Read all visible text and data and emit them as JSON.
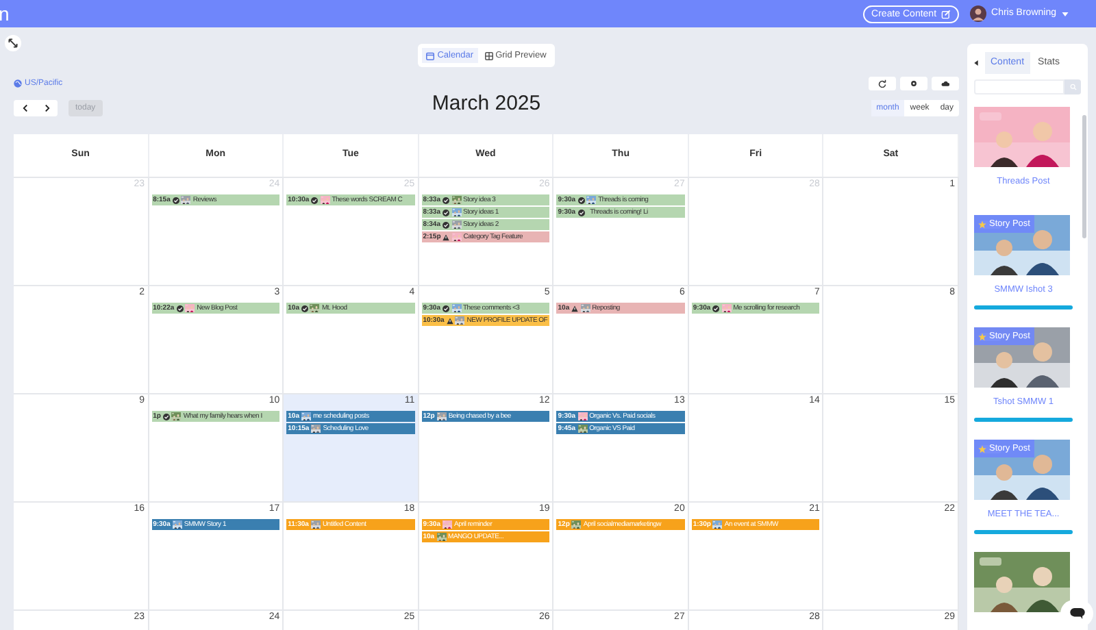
{
  "top_bar": {
    "brand_fragment": "n",
    "create_button": "Create Content",
    "user_name": "Chris Browning"
  },
  "view_toggle": [
    {
      "label": "Calendar",
      "selected": true
    },
    {
      "label": "Grid Preview",
      "selected": false
    }
  ],
  "timezone": "US/Pacific",
  "today_button": {
    "label": "today",
    "disabled": true
  },
  "title": "March 2025",
  "view_buttons": [
    {
      "label": "month",
      "selected": true
    },
    {
      "label": "week",
      "selected": false
    },
    {
      "label": "day",
      "selected": false
    }
  ],
  "weekdays": [
    "Sun",
    "Mon",
    "Tue",
    "Wed",
    "Thu",
    "Fri",
    "Sat"
  ],
  "weeks": [
    {
      "days": [
        {
          "number": "23",
          "other_month": true,
          "today": false
        },
        {
          "number": "24",
          "other_month": true,
          "today": false,
          "events": [
            {
              "time": "8:15a",
              "kind": "published",
              "thumbnail": true,
              "title": "Reviews",
              "color": "#b5d6b0"
            }
          ]
        },
        {
          "number": "25",
          "other_month": true,
          "today": false,
          "events": [
            {
              "time": "10:30a",
              "kind": "published",
              "thumbnail": true,
              "title": "These words SCREAM C",
              "color": "#b5d6b0"
            }
          ]
        },
        {
          "number": "26",
          "other_month": true,
          "today": false,
          "events": [
            {
              "time": "8:33a",
              "kind": "published",
              "thumbnail": true,
              "title": "Story idea 3",
              "color": "#b5d6b0"
            },
            {
              "time": "8:33a",
              "kind": "published",
              "thumbnail": true,
              "title": "Story ideas 1",
              "color": "#b5d6b0"
            },
            {
              "time": "8:34a",
              "kind": "published",
              "thumbnail": true,
              "title": "Story ideas 2",
              "color": "#b5d6b0"
            },
            {
              "time": "2:15p",
              "kind": "warning",
              "thumbnail": true,
              "title": "Category Tag Feature",
              "color": "#e8b4b4"
            }
          ]
        },
        {
          "number": "27",
          "other_month": true,
          "today": false,
          "events": [
            {
              "time": "9:30a",
              "kind": "published",
              "thumbnail": true,
              "title": "Threads is coming",
              "color": "#b5d6b0"
            },
            {
              "time": "9:30a",
              "kind": "published",
              "thumbnail": false,
              "title": "Threads is coming! Li",
              "color": "#b5d6b0"
            }
          ]
        },
        {
          "number": "28",
          "other_month": true,
          "today": false
        },
        {
          "number": "1",
          "other_month": false,
          "today": false
        }
      ]
    },
    {
      "days": [
        {
          "number": "2",
          "other_month": false,
          "today": false
        },
        {
          "number": "3",
          "other_month": false,
          "today": false,
          "events": [
            {
              "time": "10:22a",
              "kind": "published",
              "thumbnail": true,
              "title": "New Blog Post",
              "color": "#b5d6b0"
            }
          ]
        },
        {
          "number": "4",
          "other_month": false,
          "today": false,
          "events": [
            {
              "time": "10a",
              "kind": "published",
              "thumbnail": true,
              "title": "Mt. Hood",
              "color": "#b5d6b0"
            }
          ]
        },
        {
          "number": "5",
          "other_month": false,
          "today": false,
          "events": [
            {
              "time": "9:30a",
              "kind": "published",
              "thumbnail": true,
              "title": "These comments <3",
              "color": "#b5d6b0"
            },
            {
              "time": "10:30a",
              "kind": "warning",
              "thumbnail": true,
              "title": "NEW PROFILE UPDATE OF",
              "color": "#fbbf47"
            }
          ]
        },
        {
          "number": "6",
          "other_month": false,
          "today": false,
          "events": [
            {
              "time": "10a",
              "kind": "warning",
              "thumbnail": true,
              "title": "Reposting",
              "color": "#e8b4b4"
            }
          ]
        },
        {
          "number": "7",
          "other_month": false,
          "today": false,
          "events": [
            {
              "time": "9:30a",
              "kind": "published",
              "thumbnail": true,
              "title": "Me scrolling for research",
              "color": "#b5d6b0"
            }
          ]
        },
        {
          "number": "8",
          "other_month": false,
          "today": false
        }
      ]
    },
    {
      "days": [
        {
          "number": "9",
          "other_month": false,
          "today": false
        },
        {
          "number": "10",
          "other_month": false,
          "today": false,
          "events": [
            {
              "time": "1p",
              "kind": "published",
              "thumbnail": true,
              "title": "What my family hears when I",
              "color": "#b5d6b0"
            }
          ]
        },
        {
          "number": "11",
          "other_month": false,
          "today": true,
          "events": [
            {
              "time": "10a",
              "kind": "plain",
              "thumbnail": true,
              "title": "me scheduling posts",
              "color": "#3a7fb0"
            },
            {
              "time": "10:15a",
              "kind": "plain",
              "thumbnail": true,
              "title": "Scheduling Love",
              "color": "#3a7fb0"
            }
          ]
        },
        {
          "number": "12",
          "other_month": false,
          "today": false,
          "events": [
            {
              "time": "12p",
              "kind": "plain",
              "thumbnail": true,
              "title": "Being chased by a bee",
              "color": "#3a7fb0"
            }
          ]
        },
        {
          "number": "13",
          "other_month": false,
          "today": false,
          "events": [
            {
              "time": "9:30a",
              "kind": "plain",
              "thumbnail": true,
              "title": "Organic Vs. Paid socials",
              "color": "#3a7fb0"
            },
            {
              "time": "9:45a",
              "kind": "plain",
              "thumbnail": true,
              "title": "Organic VS Paid",
              "color": "#3a7fb0"
            }
          ]
        },
        {
          "number": "14",
          "other_month": false,
          "today": false
        },
        {
          "number": "15",
          "other_month": false,
          "today": false
        }
      ]
    },
    {
      "days": [
        {
          "number": "16",
          "other_month": false,
          "today": false
        },
        {
          "number": "17",
          "other_month": false,
          "today": false,
          "events": [
            {
              "time": "9:30a",
              "kind": "plain",
              "thumbnail": true,
              "title": "SMMW Story 1",
              "color": "#3a7fb0"
            }
          ]
        },
        {
          "number": "18",
          "other_month": false,
          "today": false,
          "events": [
            {
              "time": "11:30a",
              "kind": "plain",
              "thumbnail": true,
              "title": "Untitled Content",
              "color": "#f7a21b"
            }
          ]
        },
        {
          "number": "19",
          "other_month": false,
          "today": false,
          "events": [
            {
              "time": "9:30a",
              "kind": "plain",
              "thumbnail": true,
              "title": "April reminder",
              "color": "#f7a21b"
            },
            {
              "time": "10a",
              "kind": "plain",
              "thumbnail": true,
              "title": "MANGO UPDATE...",
              "color": "#f7a21b"
            }
          ]
        },
        {
          "number": "20",
          "other_month": false,
          "today": false,
          "events": [
            {
              "time": "12p",
              "kind": "plain",
              "thumbnail": true,
              "title": "April socialmediamarketingw",
              "color": "#f7a21b"
            }
          ]
        },
        {
          "number": "21",
          "other_month": false,
          "today": false,
          "events": [
            {
              "time": "1:30p",
              "kind": "plain",
              "thumbnail": true,
              "title": "An event at SMMW",
              "color": "#f7a21b"
            }
          ]
        },
        {
          "number": "22",
          "other_month": false,
          "today": false
        }
      ]
    },
    {
      "days": [
        {
          "number": "23",
          "other_month": false,
          "today": false
        },
        {
          "number": "24",
          "other_month": false,
          "today": false
        },
        {
          "number": "25",
          "other_month": false,
          "today": false
        },
        {
          "number": "26",
          "other_month": false,
          "today": false
        },
        {
          "number": "27",
          "other_month": false,
          "today": false
        },
        {
          "number": "28",
          "other_month": false,
          "today": false
        },
        {
          "number": "29",
          "other_month": false,
          "today": false
        }
      ]
    }
  ],
  "sidebar": {
    "tabs": [
      {
        "label": "Content",
        "selected": true
      },
      {
        "label": "Stats",
        "selected": false
      }
    ],
    "cards": [
      {
        "kind": "picture",
        "title": "Threads Post",
        "bar": false
      },
      {
        "kind": "picture",
        "story_badge": "Story Post",
        "title": "SMMW Ishot 3",
        "bar": true
      },
      {
        "kind": "picture",
        "story_badge": "Story Post",
        "title": "Tshot SMMW 1",
        "bar": true
      },
      {
        "kind": "picture",
        "story_badge": "Story Post",
        "title": "MEET THE TEA...",
        "bar": true
      },
      {
        "kind": "picture",
        "bar": false
      }
    ]
  }
}
